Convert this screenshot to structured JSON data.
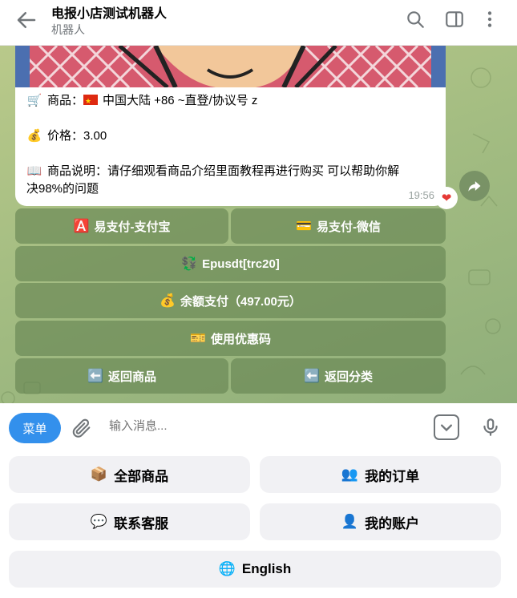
{
  "header": {
    "title": "电报小店测试机器人",
    "subtitle": "机器人"
  },
  "message": {
    "product_label": "商品：",
    "product_value": "中国大陆 +86 ~直登/协议号 z",
    "price_label": "价格：",
    "price_value": "3.00",
    "desc_label": "商品说明：",
    "desc_value_line1": "请仔细观看商品介绍里面教程再进行购买 可以帮助你解",
    "desc_value_line2": "决98%的问题",
    "time": "19:56",
    "icons": {
      "product": "cart-icon",
      "price": "money-bag-icon",
      "desc": "book-icon",
      "reaction": "heart-icon"
    }
  },
  "inline_keyboard": {
    "alipay": {
      "icon": "🅰️",
      "label": "易支付-支付宝"
    },
    "wechat": {
      "icon": "💳",
      "label": "易支付-微信"
    },
    "epusdt": {
      "icon": "💱",
      "label": "Epusdt[trc20]"
    },
    "balance": {
      "icon": "💰",
      "label": "余额支付（497.00元）"
    },
    "coupon": {
      "icon": "🎫",
      "label": "使用优惠码"
    },
    "back_product": {
      "icon": "⬅️",
      "label": "返回商品"
    },
    "back_category": {
      "icon": "⬅️",
      "label": "返回分类"
    }
  },
  "composer": {
    "menu_label": "菜单",
    "placeholder": "输入消息..."
  },
  "reply_keyboard": {
    "all_products": {
      "icon": "📦",
      "label": "全部商品"
    },
    "my_orders": {
      "icon": "👥",
      "label": "我的订单"
    },
    "contact": {
      "icon": "💬",
      "label": "联系客服"
    },
    "my_account": {
      "icon": "👤",
      "label": "我的账户"
    },
    "english": {
      "icon": "🌐",
      "label": "English"
    }
  },
  "colors": {
    "accent": "#3390ec",
    "chat_bg": "#a4bd82",
    "inline_button": "#6f8f5a",
    "reply_button": "#f1f1f4"
  }
}
